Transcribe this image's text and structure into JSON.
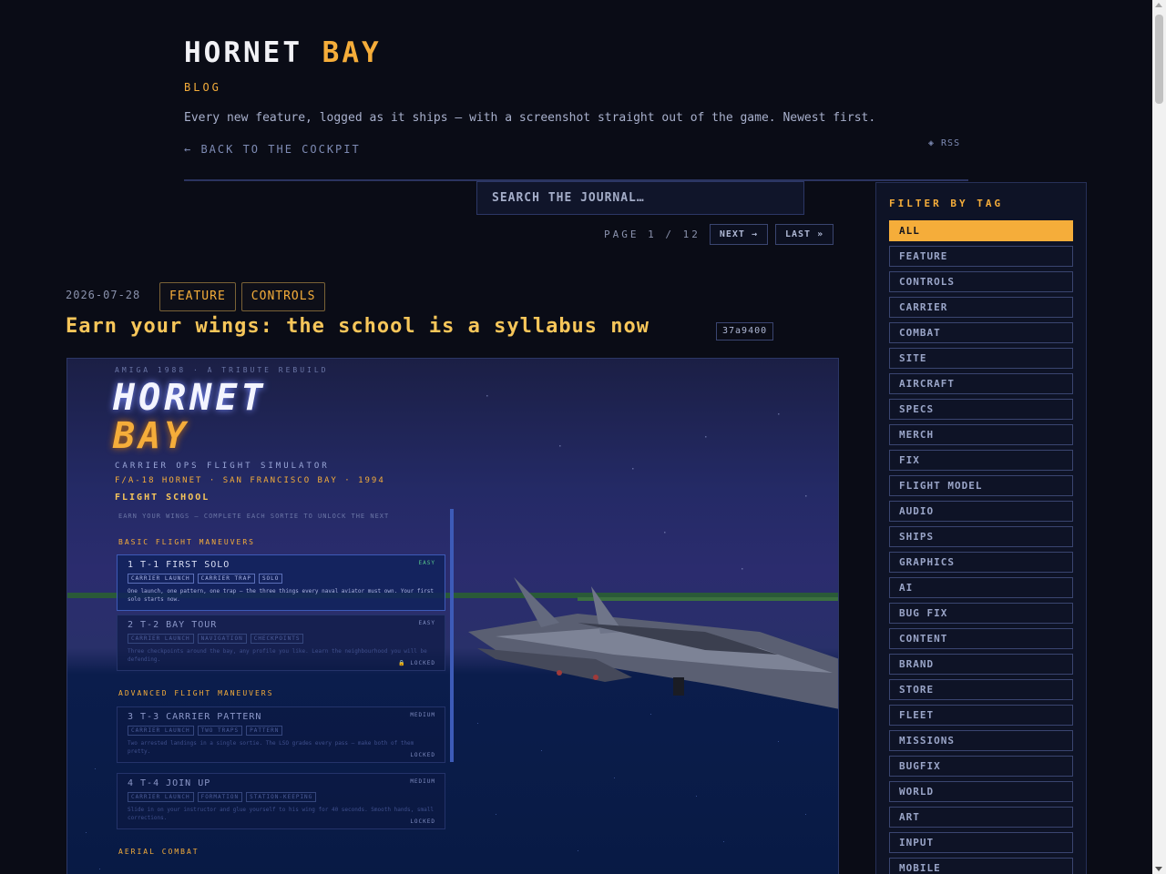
{
  "header": {
    "brand_part1": "HORNET",
    "brand_part2": "BAY",
    "section_label": "BLOG",
    "tagline": "Every new feature, logged as it ships — with a screenshot straight out of the game. Newest first.",
    "back_link": "← BACK TO THE COCKPIT",
    "rss": "◈ RSS"
  },
  "search": {
    "placeholder": "SEARCH THE JOURNAL…"
  },
  "pagination": {
    "indicator": "PAGE 1 / 12",
    "next_label": "NEXT →",
    "last_label": "LAST »"
  },
  "post": {
    "date": "2026-07-28",
    "tags": [
      "FEATURE",
      "CONTROLS"
    ],
    "title": "Earn your wings: the school is a syllabus now",
    "commit": "37a9400",
    "screenshot": {
      "kicker": "AMIGA 1988 · A TRIBUTE REBUILD",
      "logo_line1": "HORNET",
      "logo_line2": "BAY",
      "subtitle1": "CARRIER OPS FLIGHT SIMULATOR",
      "subtitle2": "F/A-18 HORNET · SAN FRANCISCO BAY · 1994",
      "school_title": "FLIGHT SCHOOL",
      "school_hint": "EARN YOUR WINGS — COMPLETE EACH SORTIE TO UNLOCK THE NEXT",
      "sections": [
        "BASIC FLIGHT MANEUVERS",
        "ADVANCED FLIGHT MANEUVERS",
        "AERIAL COMBAT"
      ],
      "lessons": [
        {
          "title": "1  T-1 FIRST SOLO",
          "difficulty": "EASY",
          "chips": [
            "CARRIER LAUNCH",
            "CARRIER TRAP",
            "SOLO"
          ],
          "desc": "One launch, one pattern, one trap — the three things every naval aviator must own. Your first solo starts now.",
          "lock": ""
        },
        {
          "title": "2  T-2 BAY TOUR",
          "difficulty": "EASY",
          "chips": [
            "CARRIER LAUNCH",
            "NAVIGATION",
            "CHECKPOINTS"
          ],
          "desc": "Three checkpoints around the bay, any profile you like. Learn the neighbourhood you will be defending.",
          "lock": "🔒 LOCKED"
        },
        {
          "title": "3  T-3 CARRIER PATTERN",
          "difficulty": "MEDIUM",
          "chips": [
            "CARRIER LAUNCH",
            "TWO TRAPS",
            "PATTERN"
          ],
          "desc": "Two arrested landings in a single sortie. The LSO grades every pass — make both of them pretty.",
          "lock": "LOCKED"
        },
        {
          "title": "4  T-4 JOIN UP",
          "difficulty": "MEDIUM",
          "chips": [
            "CARRIER LAUNCH",
            "FORMATION",
            "STATION-KEEPING"
          ],
          "desc": "Slide in on your instructor and glue yourself to his wing for 40 seconds. Smooth hands, small corrections.",
          "lock": "LOCKED"
        }
      ]
    }
  },
  "filter": {
    "title": "FILTER BY TAG",
    "tags": [
      "ALL",
      "FEATURE",
      "CONTROLS",
      "CARRIER",
      "COMBAT",
      "SITE",
      "AIRCRAFT",
      "SPECS",
      "MERCH",
      "FIX",
      "FLIGHT MODEL",
      "AUDIO",
      "SHIPS",
      "GRAPHICS",
      "AI",
      "BUG FIX",
      "CONTENT",
      "BRAND",
      "STORE",
      "FLEET",
      "MISSIONS",
      "BUGFIX",
      "WORLD",
      "ART",
      "INPUT",
      "MOBILE"
    ],
    "active": "ALL"
  },
  "colors": {
    "background": "#0a0c16",
    "accent": "#f5ad3a",
    "title": "#f7c65a",
    "muted": "#7e8bb4"
  }
}
